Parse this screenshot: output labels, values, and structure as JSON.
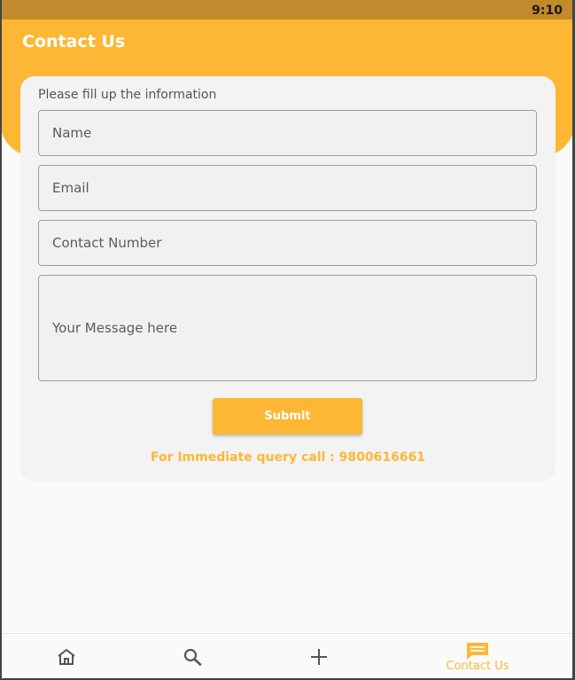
{
  "status_bar": {
    "time": "9:10"
  },
  "header": {
    "title": "Contact Us"
  },
  "form": {
    "subtitle": "Please fill up the information",
    "name_placeholder": "Name",
    "email_placeholder": "Email",
    "contact_placeholder": "Contact Number",
    "message_placeholder": "Your Message here",
    "submit_label": "Submit",
    "query_text": "For Immediate query call : 9800616661"
  },
  "bottom_nav": {
    "items": [
      {
        "icon": "home-icon",
        "label": ""
      },
      {
        "icon": "search-icon",
        "label": ""
      },
      {
        "icon": "plus-icon",
        "label": ""
      },
      {
        "icon": "chat-icon",
        "label": "Contact Us",
        "active": true
      }
    ]
  },
  "colors": {
    "accent": "#fdb734",
    "status_bar": "#c28a2c",
    "card": "#f3f3f3",
    "background": "#fafafa"
  }
}
